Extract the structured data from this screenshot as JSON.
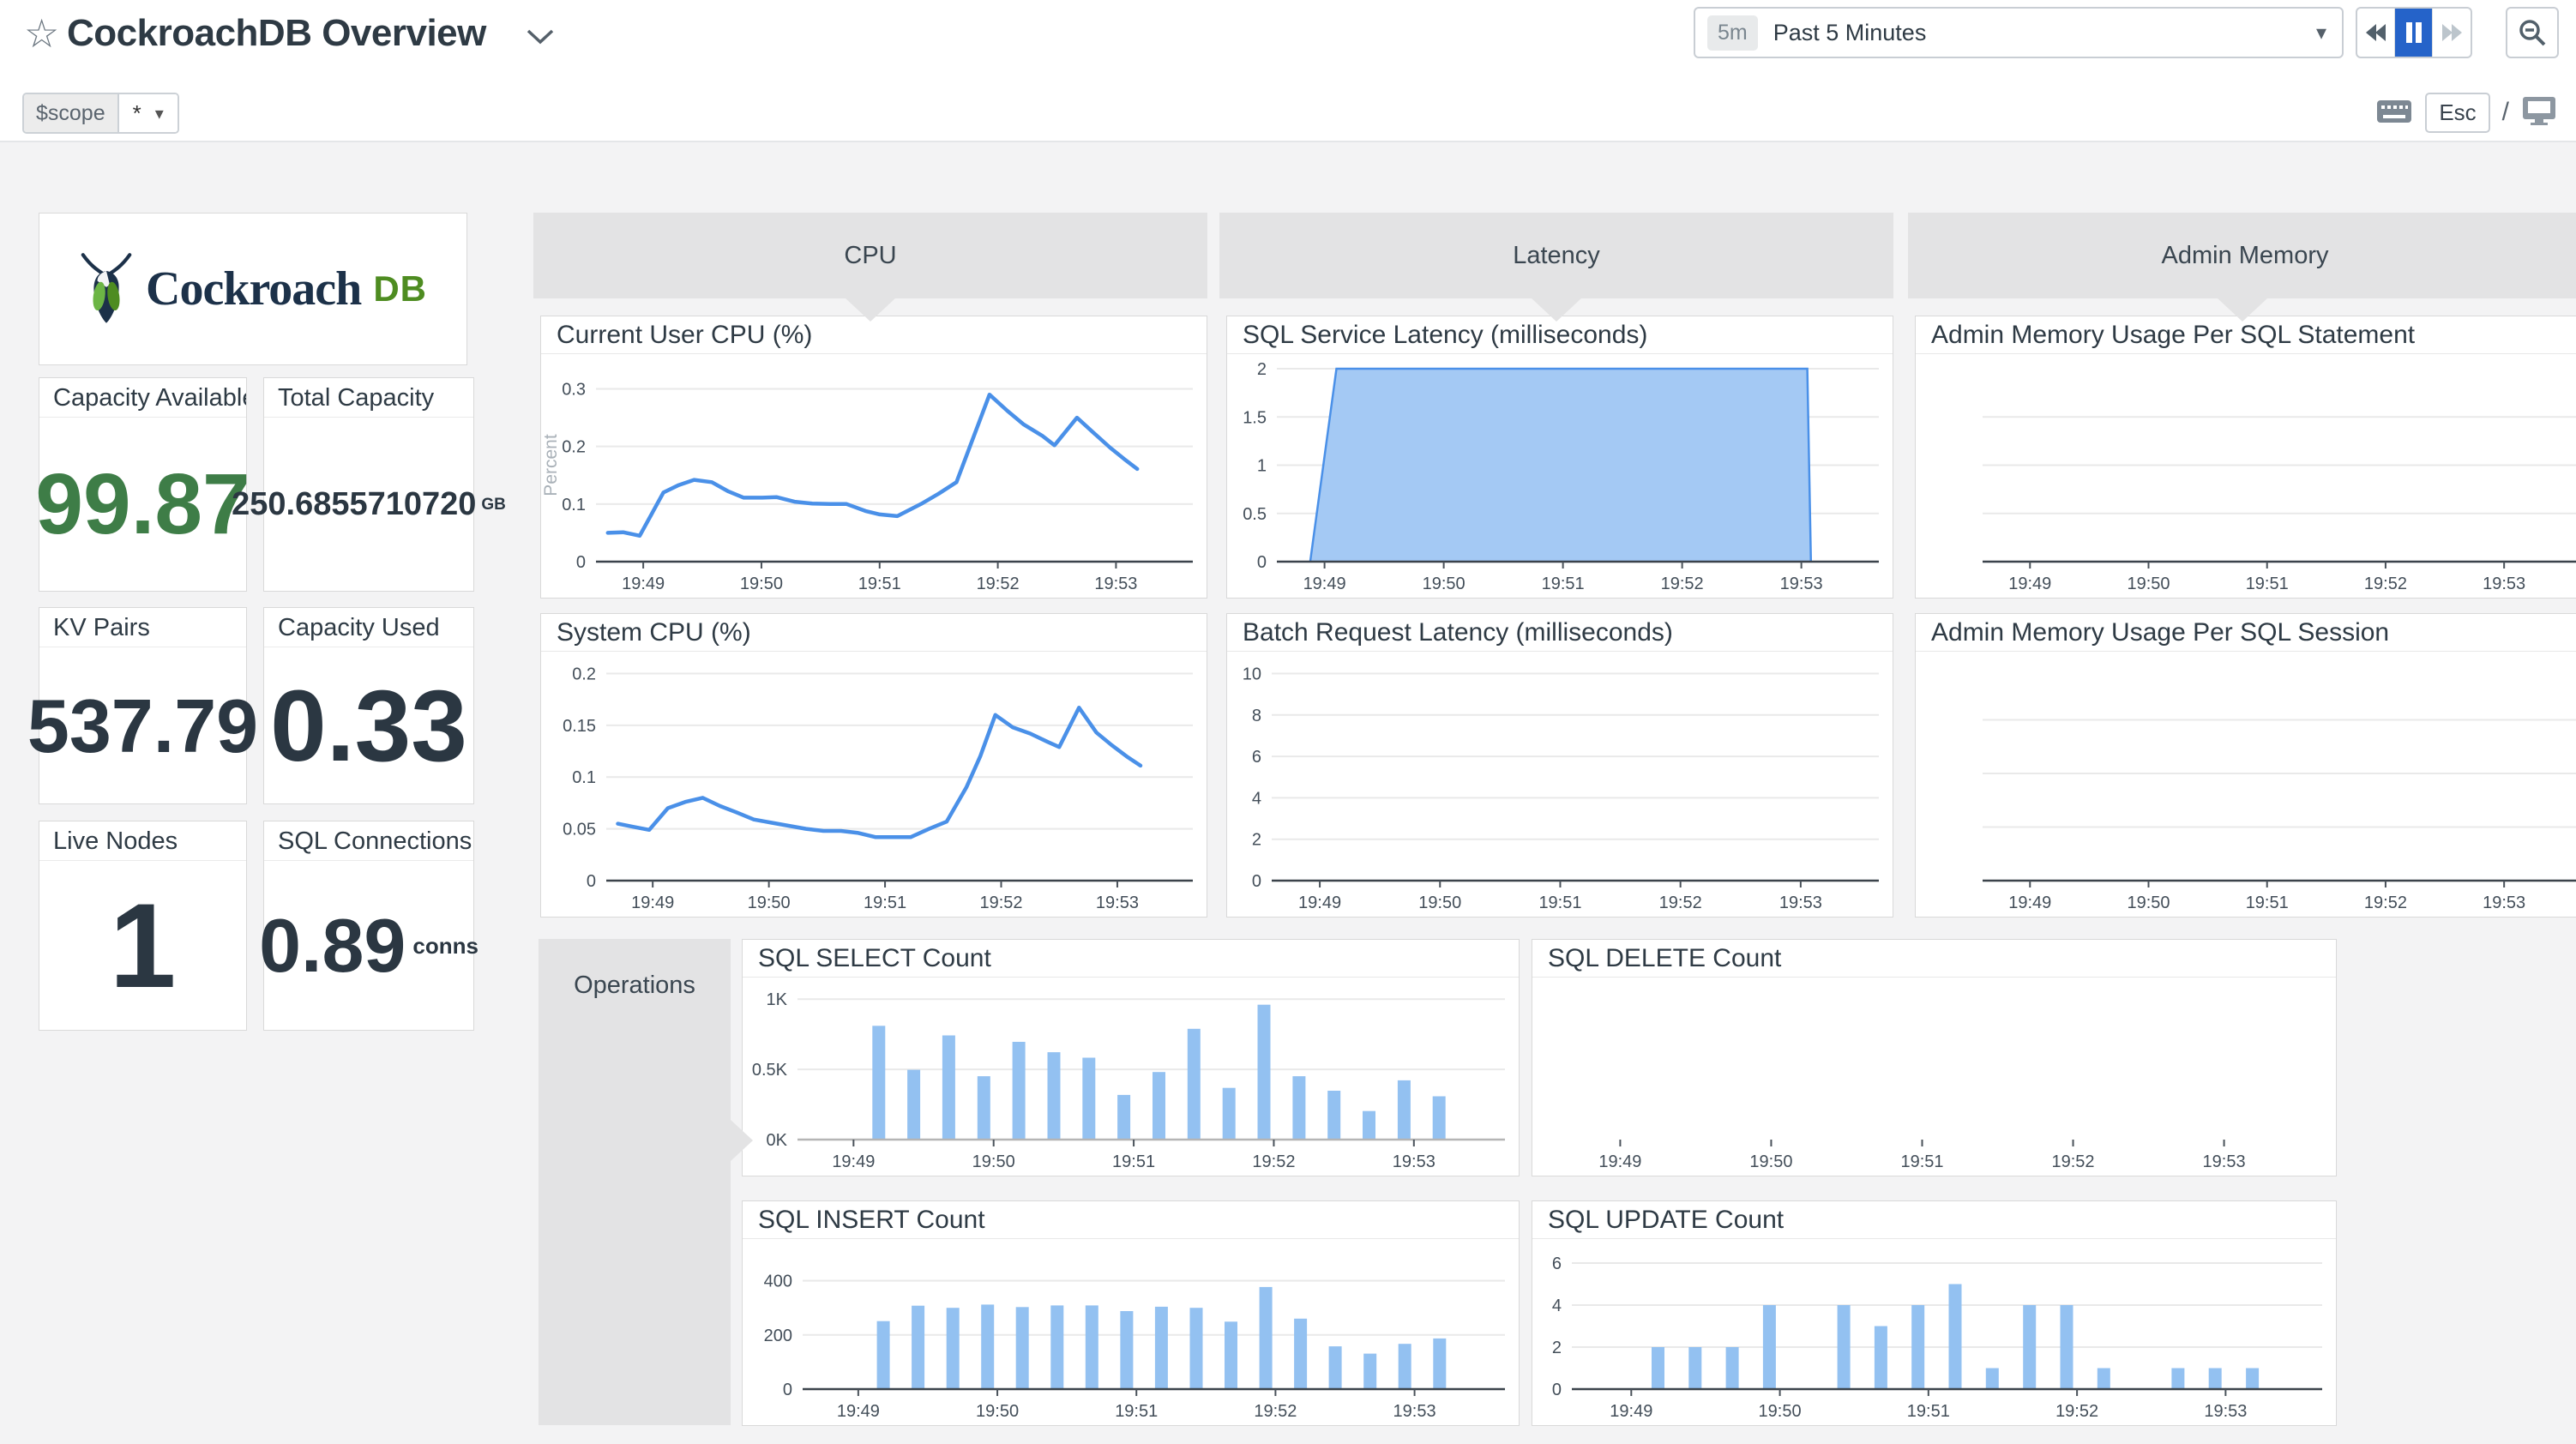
{
  "title_bar": {
    "title": "CockroachDB Overview"
  },
  "time_bar": {
    "badge": "5m",
    "label": "Past 5 Minutes"
  },
  "shortcut_bar": {
    "esc": "Esc",
    "slash": "/"
  },
  "scope_bar": {
    "label": "$scope",
    "value": "*"
  },
  "logo": {
    "word": "Cockroach",
    "db": "DB"
  },
  "stats": [
    {
      "label": "Capacity Available...",
      "value": "99.87",
      "unit": "",
      "style": "green-lg"
    },
    {
      "label": "Total Capacity",
      "value": "250.6855710720",
      "unit": "GB",
      "style": "small"
    },
    {
      "label": "KV Pairs",
      "value": "537.79",
      "unit": "",
      "style": "md"
    },
    {
      "label": "Capacity Used",
      "value": "0.33",
      "unit": "",
      "style": "xl"
    },
    {
      "label": "Live Nodes",
      "value": "1",
      "unit": "",
      "style": "xxl"
    },
    {
      "label": "SQL Connections",
      "value": "0.89",
      "unit": "conns",
      "style": "md"
    }
  ],
  "groups": {
    "cpu": "CPU",
    "latency": "Latency",
    "admin_memory": "Admin Memory",
    "operations": "Operations"
  },
  "colors": {
    "line": "#4a90e8",
    "area_fill": "#a4c9f4",
    "bar": "#93c1f1",
    "grid": "#e9e9e9",
    "axis_dark": "#3b434b",
    "axis_light": "#b5b5b5",
    "tick_text": "#434e59",
    "accent_blue": "#2563c9",
    "green": "#3e7d47",
    "navy": "#1c3149",
    "db_green": "#4e8c21"
  },
  "time_axis": {
    "tmin": 48.6,
    "tmax": 53.65,
    "ticks": [
      [
        49,
        "19:49"
      ],
      [
        50,
        "19:50"
      ],
      [
        51,
        "19:51"
      ],
      [
        52,
        "19:52"
      ],
      [
        53,
        "19:53"
      ]
    ]
  },
  "chart_data": [
    {
      "id": "user_cpu",
      "type": "line",
      "title": "Current User CPU (%)",
      "ylabel": "Percent",
      "ymax": 0.335,
      "padL": 64,
      "yticks": [
        [
          0,
          "0"
        ],
        [
          0.1,
          "0.1"
        ],
        [
          0.2,
          "0.2"
        ],
        [
          0.3,
          "0.3"
        ]
      ],
      "points": [
        [
          48.7,
          0.05
        ],
        [
          48.83,
          0.051
        ],
        [
          48.97,
          0.045
        ],
        [
          49.17,
          0.12
        ],
        [
          49.3,
          0.133
        ],
        [
          49.43,
          0.142
        ],
        [
          49.58,
          0.138
        ],
        [
          49.72,
          0.122
        ],
        [
          49.85,
          0.111
        ],
        [
          50.0,
          0.111
        ],
        [
          50.13,
          0.112
        ],
        [
          50.28,
          0.104
        ],
        [
          50.43,
          0.101
        ],
        [
          50.58,
          0.1
        ],
        [
          50.72,
          0.1
        ],
        [
          50.88,
          0.088
        ],
        [
          51.0,
          0.082
        ],
        [
          51.15,
          0.079
        ],
        [
          51.35,
          0.1
        ],
        [
          51.5,
          0.118
        ],
        [
          51.65,
          0.138
        ],
        [
          51.93,
          0.29
        ],
        [
          52.08,
          0.262
        ],
        [
          52.22,
          0.238
        ],
        [
          52.38,
          0.218
        ],
        [
          52.48,
          0.202
        ],
        [
          52.67,
          0.25
        ],
        [
          52.82,
          0.222
        ],
        [
          52.95,
          0.198
        ],
        [
          53.07,
          0.178
        ],
        [
          53.18,
          0.161
        ]
      ]
    },
    {
      "id": "system_cpu",
      "type": "line",
      "title": "System CPU (%)",
      "ymax": 0.207,
      "padL": 76,
      "yticks": [
        [
          0,
          "0"
        ],
        [
          0.05,
          "0.05"
        ],
        [
          0.1,
          "0.1"
        ],
        [
          0.15,
          "0.15"
        ],
        [
          0.2,
          "0.2"
        ]
      ],
      "points": [
        [
          48.7,
          0.055
        ],
        [
          48.83,
          0.052
        ],
        [
          48.97,
          0.049
        ],
        [
          49.13,
          0.07
        ],
        [
          49.28,
          0.076
        ],
        [
          49.43,
          0.08
        ],
        [
          49.58,
          0.072
        ],
        [
          49.72,
          0.066
        ],
        [
          49.87,
          0.059
        ],
        [
          50.02,
          0.056
        ],
        [
          50.17,
          0.053
        ],
        [
          50.32,
          0.05
        ],
        [
          50.47,
          0.048
        ],
        [
          50.62,
          0.048
        ],
        [
          50.77,
          0.046
        ],
        [
          50.92,
          0.042
        ],
        [
          51.07,
          0.042
        ],
        [
          51.22,
          0.042
        ],
        [
          51.38,
          0.05
        ],
        [
          51.53,
          0.057
        ],
        [
          51.7,
          0.09
        ],
        [
          51.82,
          0.12
        ],
        [
          51.95,
          0.16
        ],
        [
          52.1,
          0.148
        ],
        [
          52.25,
          0.142
        ],
        [
          52.4,
          0.134
        ],
        [
          52.5,
          0.129
        ],
        [
          52.67,
          0.167
        ],
        [
          52.82,
          0.143
        ],
        [
          52.95,
          0.131
        ],
        [
          53.08,
          0.12
        ],
        [
          53.2,
          0.111
        ]
      ]
    },
    {
      "id": "sql_service_latency",
      "type": "area",
      "title": "SQL Service Latency (milliseconds)",
      "ymax": 2.0,
      "padL": 58,
      "yticks": [
        [
          0,
          "0"
        ],
        [
          0.5,
          "0.5"
        ],
        [
          1,
          "1"
        ],
        [
          1.5,
          "1.5"
        ],
        [
          2,
          "2"
        ]
      ],
      "points": [
        [
          48.88,
          0
        ],
        [
          49.1,
          2.0
        ],
        [
          53.05,
          2.0
        ],
        [
          53.08,
          0
        ]
      ]
    },
    {
      "id": "batch_request_latency",
      "type": "empty",
      "title": "Batch Request Latency (milliseconds)",
      "ymax": 10.35,
      "padL": 52,
      "axis": "dark",
      "yticks": [
        [
          0,
          "0"
        ],
        [
          2,
          "2"
        ],
        [
          4,
          "4"
        ],
        [
          6,
          "6"
        ],
        [
          8,
          "8"
        ],
        [
          10,
          "10"
        ]
      ]
    },
    {
      "id": "admin_mem_statement",
      "type": "empty",
      "title": "Admin Memory Usage Per SQL Statement",
      "ymax": 1,
      "padL": 78,
      "padR": 0,
      "gridlines": 3,
      "axis": "dark",
      "yticks": []
    },
    {
      "id": "admin_mem_session",
      "type": "empty",
      "title": "Admin Memory Usage Per SQL Session",
      "ymax": 1,
      "padL": 78,
      "padR": 0,
      "gridlines": 3,
      "axis": "dark",
      "yticks": []
    },
    {
      "id": "sql_select_count",
      "type": "bars",
      "title": "SQL SELECT Count",
      "ymax": 1050,
      "padL": 64,
      "axis": "light",
      "yticks": [
        [
          0,
          "0K"
        ],
        [
          500,
          "0.5K"
        ],
        [
          1000,
          "1K"
        ]
      ],
      "t0": 49.18,
      "dt": 0.25,
      "values": [
        810,
        497,
        742,
        451,
        696,
        622,
        583,
        318,
        481,
        789,
        368,
        960,
        451,
        348,
        203,
        422,
        308
      ]
    },
    {
      "id": "sql_delete_count",
      "type": "empty",
      "title": "SQL DELETE Count",
      "ymax": 1,
      "padL": 32,
      "axis": "none",
      "yticks": []
    },
    {
      "id": "sql_insert_count",
      "type": "bars",
      "title": "SQL INSERT Count",
      "ymax": 500,
      "padL": 70,
      "axis": "dark",
      "yticks": [
        [
          0,
          "0"
        ],
        [
          200,
          "200"
        ],
        [
          400,
          "400"
        ]
      ],
      "t0": 49.18,
      "dt": 0.25,
      "values": [
        251,
        308,
        300,
        312,
        303,
        309,
        309,
        288,
        304,
        300,
        249,
        377,
        260,
        158,
        131,
        167,
        187
      ]
    },
    {
      "id": "sql_update_count",
      "type": "bars",
      "title": "SQL UPDATE Count",
      "ymax": 6.45,
      "padL": 46,
      "axis": "dark",
      "yticks": [
        [
          0,
          "0"
        ],
        [
          2,
          "2"
        ],
        [
          4,
          "4"
        ],
        [
          6,
          "6"
        ]
      ],
      "t0": 49.18,
      "dt": 0.25,
      "values": [
        2,
        2,
        2,
        4,
        0,
        4,
        3,
        4,
        5,
        1,
        4,
        4,
        1,
        0,
        1,
        1,
        1
      ]
    }
  ]
}
